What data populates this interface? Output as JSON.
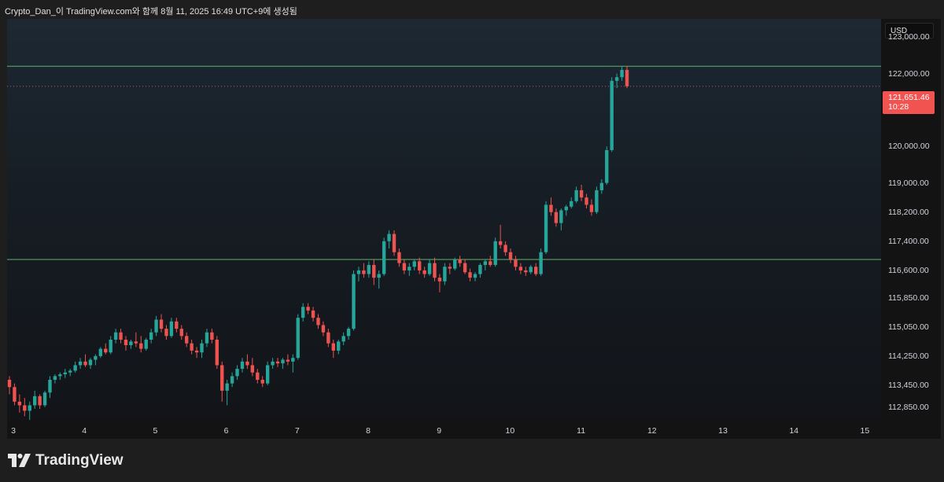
{
  "header": {
    "text": "Crypto_Dan_이 TradingView.com와 함께 8월 11, 2025 16:49 UTC+9에 생성됨"
  },
  "currency": "USD",
  "last_price": {
    "value": "121,651.46",
    "countdown": "10:28",
    "color": "#f05350"
  },
  "brand": {
    "name": "TradingView"
  },
  "colors": {
    "up": "#26a69a",
    "down": "#ef5350",
    "hline": "#5fb36b"
  },
  "chart_data": {
    "type": "candlestick",
    "y_ticks": [
      "123,000.00",
      "122,000.00",
      "121,000.00",
      "120,000.00",
      "119,000.00",
      "118,200.00",
      "117,400.00",
      "116,600.00",
      "115,850.00",
      "115,050.00",
      "114,250.00",
      "113,450.00",
      "112,850.00"
    ],
    "x_ticks": [
      "3",
      "4",
      "5",
      "6",
      "7",
      "8",
      "9",
      "10",
      "11",
      "12",
      "13",
      "14",
      "15"
    ],
    "ylim": [
      112500,
      123500
    ],
    "horizontal_lines": [
      122200,
      116900
    ],
    "last_price_line": 121651.46,
    "candles": [
      [
        113600,
        113700,
        113200,
        113400
      ],
      [
        113400,
        113500,
        112900,
        113000
      ],
      [
        113000,
        113200,
        112700,
        112900
      ],
      [
        112900,
        113100,
        112600,
        112750
      ],
      [
        112750,
        113000,
        112500,
        112900
      ],
      [
        112900,
        113300,
        112800,
        113150
      ],
      [
        113150,
        113200,
        112800,
        112900
      ],
      [
        112900,
        113300,
        112850,
        113250
      ],
      [
        113250,
        113700,
        113100,
        113600
      ],
      [
        113600,
        113750,
        113500,
        113700
      ],
      [
        113700,
        113800,
        113600,
        113750
      ],
      [
        113750,
        113900,
        113650,
        113800
      ],
      [
        113800,
        113900,
        113700,
        113850
      ],
      [
        113850,
        114100,
        113800,
        114000
      ],
      [
        114000,
        114200,
        113900,
        114100
      ],
      [
        114100,
        114300,
        113950,
        114000
      ],
      [
        114000,
        114200,
        113900,
        114150
      ],
      [
        114150,
        114300,
        114000,
        114250
      ],
      [
        114250,
        114500,
        114200,
        114450
      ],
      [
        114450,
        114600,
        114300,
        114350
      ],
      [
        114350,
        114800,
        114300,
        114700
      ],
      [
        114700,
        115000,
        114600,
        114900
      ],
      [
        114900,
        115000,
        114600,
        114700
      ],
      [
        114700,
        114800,
        114400,
        114550
      ],
      [
        114550,
        114700,
        114450,
        114650
      ],
      [
        114650,
        114900,
        114500,
        114600
      ],
      [
        114600,
        114800,
        114350,
        114450
      ],
      [
        114450,
        114750,
        114400,
        114700
      ],
      [
        114700,
        115000,
        114600,
        114900
      ],
      [
        114900,
        115350,
        114800,
        115250
      ],
      [
        115250,
        115400,
        114900,
        115000
      ],
      [
        115000,
        115100,
        114700,
        114800
      ],
      [
        114800,
        115300,
        114750,
        115200
      ],
      [
        115200,
        115300,
        114900,
        115000
      ],
      [
        115000,
        115100,
        114700,
        114800
      ],
      [
        114800,
        114900,
        114500,
        114600
      ],
      [
        114600,
        114700,
        114300,
        114400
      ],
      [
        114400,
        114500,
        114200,
        114350
      ],
      [
        114350,
        114700,
        114200,
        114600
      ],
      [
        114600,
        115000,
        114500,
        114900
      ],
      [
        114900,
        115000,
        114600,
        114700
      ],
      [
        114700,
        114800,
        113900,
        114000
      ],
      [
        114000,
        114100,
        113000,
        113300
      ],
      [
        113300,
        113600,
        112900,
        113500
      ],
      [
        113500,
        113800,
        113400,
        113700
      ],
      [
        113700,
        114000,
        113600,
        113900
      ],
      [
        113900,
        114200,
        113800,
        114100
      ],
      [
        114100,
        114300,
        113900,
        114000
      ],
      [
        114000,
        114200,
        113700,
        113800
      ],
      [
        113800,
        113900,
        113500,
        113600
      ],
      [
        113600,
        113700,
        113400,
        113500
      ],
      [
        113500,
        114100,
        113450,
        114000
      ],
      [
        114000,
        114200,
        113900,
        114100
      ],
      [
        114100,
        114200,
        113950,
        114050
      ],
      [
        114050,
        114200,
        113900,
        114150
      ],
      [
        114150,
        114300,
        114000,
        114100
      ],
      [
        114100,
        114300,
        113800,
        114200
      ],
      [
        114200,
        115400,
        114150,
        115300
      ],
      [
        115300,
        115700,
        115200,
        115600
      ],
      [
        115600,
        115700,
        115400,
        115500
      ],
      [
        115500,
        115600,
        115200,
        115300
      ],
      [
        115300,
        115400,
        115000,
        115100
      ],
      [
        115100,
        115200,
        114800,
        114900
      ],
      [
        114900,
        115000,
        114500,
        114600
      ],
      [
        114600,
        114700,
        114200,
        114400
      ],
      [
        114400,
        114700,
        114300,
        114650
      ],
      [
        114650,
        114900,
        114550,
        114800
      ],
      [
        114800,
        115050,
        114700,
        115000
      ],
      [
        115000,
        116600,
        114950,
        116500
      ],
      [
        116500,
        116700,
        116300,
        116600
      ],
      [
        116600,
        116800,
        116400,
        116500
      ],
      [
        116500,
        116850,
        116400,
        116750
      ],
      [
        116750,
        116900,
        116200,
        116400
      ],
      [
        116400,
        116600,
        116100,
        116500
      ],
      [
        116500,
        117500,
        116450,
        117400
      ],
      [
        117400,
        117700,
        117200,
        117600
      ],
      [
        117600,
        117700,
        117000,
        117100
      ],
      [
        117100,
        117200,
        116700,
        116800
      ],
      [
        116800,
        116900,
        116500,
        116600
      ],
      [
        116600,
        116800,
        116450,
        116700
      ],
      [
        116700,
        116900,
        116600,
        116850
      ],
      [
        116850,
        116950,
        116500,
        116600
      ],
      [
        116600,
        116700,
        116400,
        116500
      ],
      [
        116500,
        116900,
        116450,
        116800
      ],
      [
        116800,
        116950,
        116300,
        116400
      ],
      [
        116400,
        116500,
        116000,
        116300
      ],
      [
        116300,
        116800,
        116200,
        116700
      ],
      [
        116700,
        116800,
        116500,
        116650
      ],
      [
        116650,
        116950,
        116600,
        116900
      ],
      [
        116900,
        117000,
        116700,
        116800
      ],
      [
        116800,
        116900,
        116500,
        116550
      ],
      [
        116550,
        116650,
        116300,
        116400
      ],
      [
        116400,
        116550,
        116300,
        116500
      ],
      [
        116500,
        116800,
        116400,
        116750
      ],
      [
        116750,
        116900,
        116600,
        116850
      ],
      [
        116850,
        117000,
        116700,
        116750
      ],
      [
        116750,
        117500,
        116700,
        117400
      ],
      [
        117400,
        117850,
        117200,
        117300
      ],
      [
        117300,
        117400,
        117000,
        117100
      ],
      [
        117100,
        117200,
        116800,
        116900
      ],
      [
        116900,
        117000,
        116600,
        116700
      ],
      [
        116700,
        116800,
        116500,
        116600
      ],
      [
        116600,
        116700,
        116450,
        116550
      ],
      [
        116550,
        116750,
        116500,
        116700
      ],
      [
        116700,
        116800,
        116450,
        116500
      ],
      [
        116500,
        117200,
        116450,
        117100
      ],
      [
        117100,
        118500,
        117050,
        118400
      ],
      [
        118400,
        118600,
        118100,
        118200
      ],
      [
        118200,
        118300,
        117800,
        117900
      ],
      [
        117900,
        118300,
        117700,
        118250
      ],
      [
        118250,
        118400,
        118100,
        118350
      ],
      [
        118350,
        118600,
        118300,
        118500
      ],
      [
        118500,
        118900,
        118450,
        118800
      ],
      [
        118800,
        118950,
        118500,
        118600
      ],
      [
        118600,
        118700,
        118300,
        118400
      ],
      [
        118400,
        118550,
        118100,
        118200
      ],
      [
        118200,
        118900,
        118150,
        118800
      ],
      [
        118800,
        119100,
        118700,
        119000
      ],
      [
        119000,
        120000,
        118950,
        119900
      ],
      [
        119900,
        121900,
        119850,
        121800
      ],
      [
        121800,
        122000,
        121600,
        121900
      ],
      [
        121900,
        122200,
        121800,
        122100
      ],
      [
        122100,
        122200,
        121600,
        121651.46
      ]
    ]
  }
}
